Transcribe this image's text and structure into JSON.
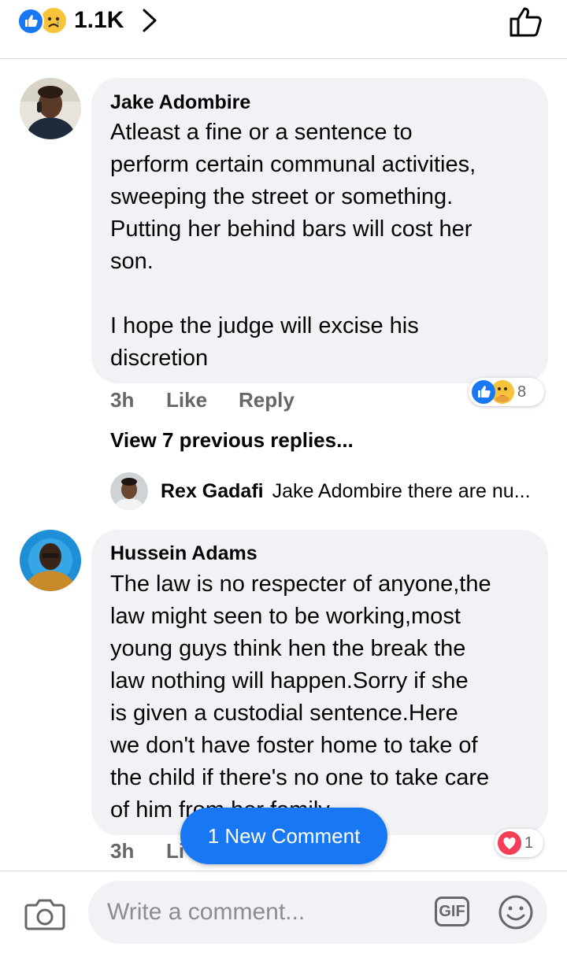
{
  "reactions_bar": {
    "count": "1.1K",
    "icons": [
      "like-reaction-icon",
      "sad-reaction-icon",
      "chevron-right-icon",
      "thumbs-up-icon"
    ]
  },
  "comments": [
    {
      "author": "Jake Adombire",
      "text": "Atleast a fine or a sentence to\nperform certain communal activities,\nsweeping the street or something.\nPutting her behind bars will cost her\nson.\n\nI hope the judge will excise his\ndiscretion",
      "time": "3h",
      "like_label": "Like",
      "reply_label": "Reply",
      "reaction_count": "8",
      "reaction_icons": [
        "like-reaction-icon",
        "care-reaction-icon"
      ]
    },
    {
      "author": "Hussein Adams",
      "text": "The law is no respecter of anyone,the\nlaw might seen to be working,most\nyoung guys think hen the break the\nlaw nothing will happen.Sorry if she\nis given a custodial sentence.Here\nwe don't have foster home to take of\nthe child if there's no one to take care\nof him from her family",
      "time": "3h",
      "like_label": "Li",
      "reaction_count": "1",
      "reaction_icons": [
        "love-reaction-icon"
      ]
    }
  ],
  "replies": {
    "view_previous_label": "View 7 previous replies...",
    "latest": {
      "author": "Rex Gadafi",
      "preview": "Jake Adombire there are nu..."
    }
  },
  "new_comment_label": "1 New Comment",
  "composer": {
    "placeholder": "Write a comment...",
    "gif_label": "GIF",
    "icons": [
      "camera-icon",
      "gif-icon",
      "emoji-icon"
    ]
  },
  "colors": {
    "accent": "#1877f2",
    "bubble": "#f0f2f5",
    "secondary_text": "#65676b",
    "love": "#f33e58"
  }
}
